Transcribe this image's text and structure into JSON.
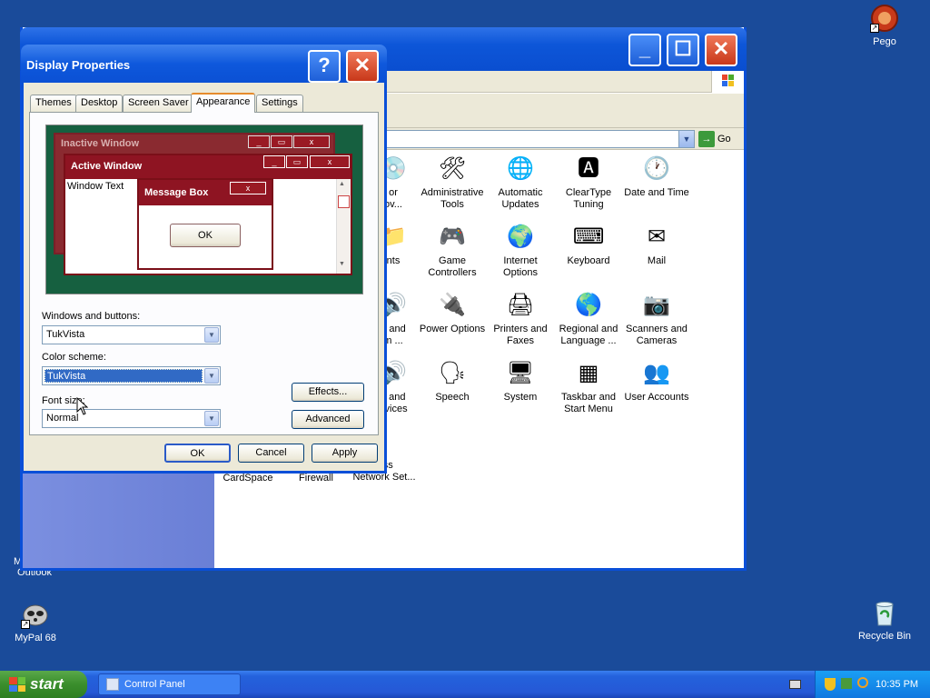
{
  "desktop": {
    "icons": [
      {
        "label": "Pego",
        "icon": "pego-icon"
      },
      {
        "label": "Outlook",
        "label_fragment": "M",
        "icon": "outlook-icon"
      },
      {
        "label": "MyPal 68",
        "icon": "mypal-icon"
      },
      {
        "label": "Recycle Bin",
        "icon": "recycle-bin-icon"
      }
    ]
  },
  "control_panel": {
    "go_label": "Go",
    "items": [
      {
        "line1": "or",
        "line2": "ov..."
      },
      {
        "line1": "Administrative",
        "line2": "Tools"
      },
      {
        "line1": "Automatic",
        "line2": "Updates"
      },
      {
        "line1": "ClearType",
        "line2": "Tuning"
      },
      {
        "line1": "Date and Time",
        "line2": ""
      },
      {
        "line1": "nts",
        "line2": ""
      },
      {
        "line1": "Game",
        "line2": "Controllers"
      },
      {
        "line1": "Internet",
        "line2": "Options"
      },
      {
        "line1": "Keyboard",
        "line2": ""
      },
      {
        "line1": "Mail",
        "line2": ""
      },
      {
        "line1": "e and",
        "line2": "m ..."
      },
      {
        "line1": "Power Options",
        "line2": ""
      },
      {
        "line1": "Printers and",
        "line2": "Faxes"
      },
      {
        "line1": "Regional and",
        "line2": "Language ..."
      },
      {
        "line1": "Scanners and",
        "line2": "Cameras"
      },
      {
        "line1": "s and",
        "line2": "evices"
      },
      {
        "line1": "Speech",
        "line2": ""
      },
      {
        "line1": "System",
        "line2": ""
      },
      {
        "line1": "Taskbar and",
        "line2": "Start Menu"
      },
      {
        "line1": "User Accounts",
        "line2": ""
      },
      {
        "line1": "CardSpace",
        "line2": ""
      },
      {
        "line1": "Firewall",
        "line2": ""
      },
      {
        "line1": "less",
        "line2": "Network Set..."
      }
    ]
  },
  "dialog": {
    "title": "Display Properties",
    "tabs": [
      "Themes",
      "Desktop",
      "Screen Saver",
      "Appearance",
      "Settings"
    ],
    "active_tab": "Appearance",
    "preview": {
      "inactive_title": "Inactive Window",
      "active_title": "Active Window",
      "window_text": "Window Text",
      "msgbox_title": "Message Box",
      "msgbox_ok": "OK"
    },
    "windows_buttons_label": "Windows and buttons:",
    "windows_buttons_value": "TukVista",
    "color_scheme_label": "Color scheme:",
    "color_scheme_value": "TukVista",
    "font_size_label": "Font size:",
    "font_size_value": "Normal",
    "effects_label": "Effects...",
    "advanced_label": "Advanced",
    "ok_label": "OK",
    "cancel_label": "Cancel",
    "apply_label": "Apply"
  },
  "taskbar": {
    "start_label": "start",
    "task_label": "Control Panel",
    "clock": "10:35 PM"
  },
  "colors": {
    "desktop": "#1a4b9a",
    "titlebar": "#0a4ed0",
    "theme_red": "#8e1422",
    "preview_bg": "#166040"
  }
}
